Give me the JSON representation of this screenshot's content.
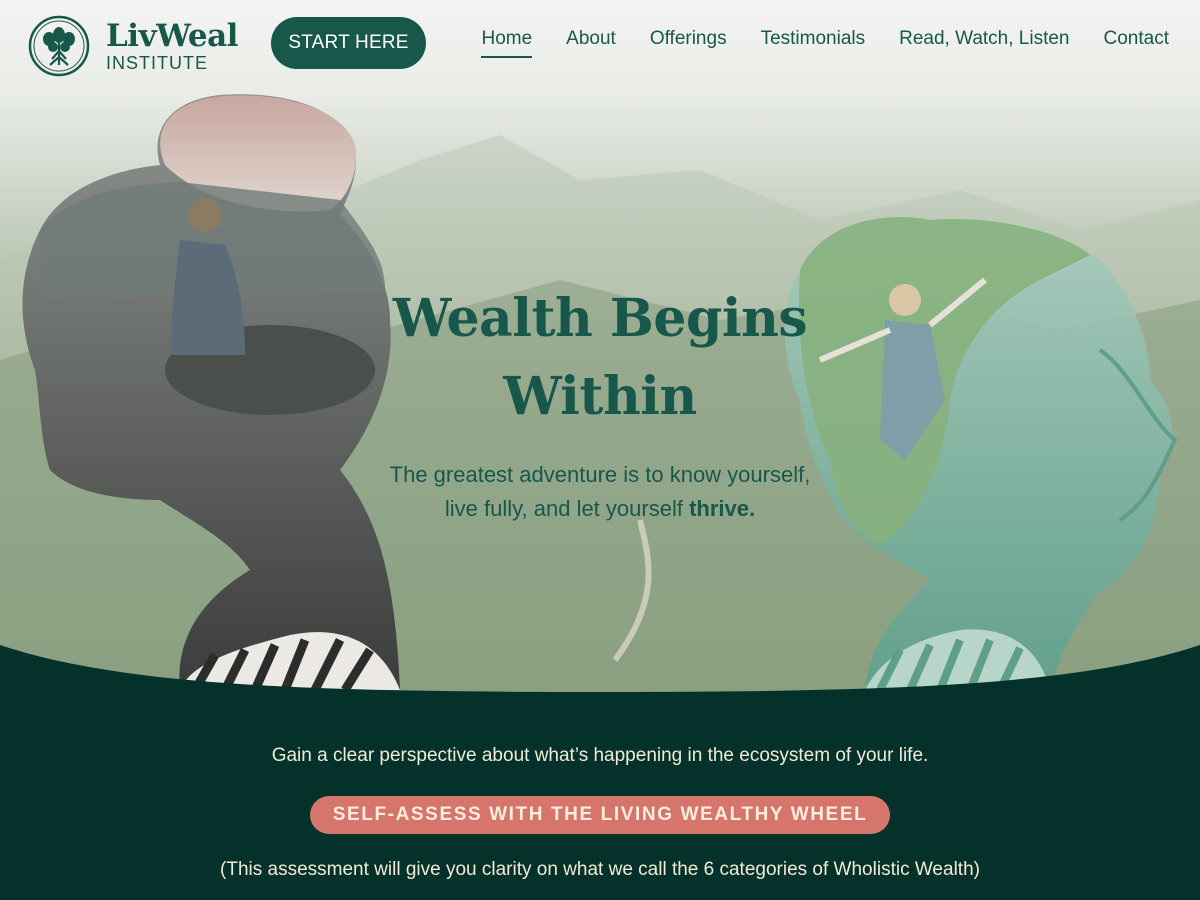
{
  "brand": {
    "name": "LivWeal",
    "subtitle": "INSTITUTE",
    "logo_icon": "tree-icon"
  },
  "header": {
    "cta_label": "START HERE",
    "nav": [
      {
        "label": "Home",
        "active": true
      },
      {
        "label": "About",
        "active": false
      },
      {
        "label": "Offerings",
        "active": false
      },
      {
        "label": "Testimonials",
        "active": false
      },
      {
        "label": "Read, Watch, Listen",
        "active": false
      },
      {
        "label": "Contact",
        "active": false
      }
    ]
  },
  "hero": {
    "title_line1": "Wealth Begins",
    "title_line2": "Within",
    "subtitle_line1": "The greatest adventure is to know yourself,",
    "subtitle_line2_pre": "live fully, and let yourself ",
    "subtitle_line2_bold": "thrive."
  },
  "assessment": {
    "intro": "Gain a clear perspective about what’s happening in the ecosystem of your life.",
    "button_label": "SELF-ASSESS WITH THE LIVING WEALTHY WHEEL",
    "note": "(This assessment will give you clarity on what we call the 6 categories of Wholistic Wealth)"
  },
  "colors": {
    "brand_green": "#17584a",
    "band_dark": "#04322b",
    "button_coral": "#d5756b",
    "text_cream": "#f1ead6"
  }
}
